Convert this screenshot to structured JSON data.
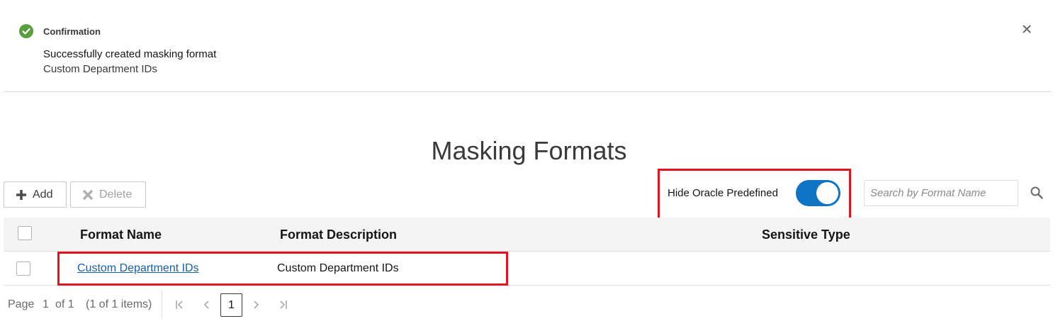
{
  "banner": {
    "title": "Confirmation",
    "message": "Successfully created masking format",
    "detail": "Custom Department IDs"
  },
  "page": {
    "title": "Masking Formats"
  },
  "toolbar": {
    "add_label": "Add",
    "delete_label": "Delete",
    "toggle_label": "Hide Oracle Predefined",
    "toggle_on": true,
    "search_placeholder": "Search by Format Name"
  },
  "table": {
    "columns": [
      "Format Name",
      "Format Description",
      "Sensitive Type"
    ],
    "rows": [
      {
        "name": "Custom Department IDs",
        "description": "Custom Department IDs",
        "sensitive_type": ""
      }
    ]
  },
  "pagination": {
    "page_label": "Page",
    "page_num": "1",
    "of_label": "of 1",
    "items_label": "(1 of 1 items)",
    "current_page": "1"
  },
  "colors": {
    "accent": "#0f74c4",
    "success": "#5a9e3d",
    "highlight": "#e2141d",
    "link": "#1a5fa8"
  }
}
